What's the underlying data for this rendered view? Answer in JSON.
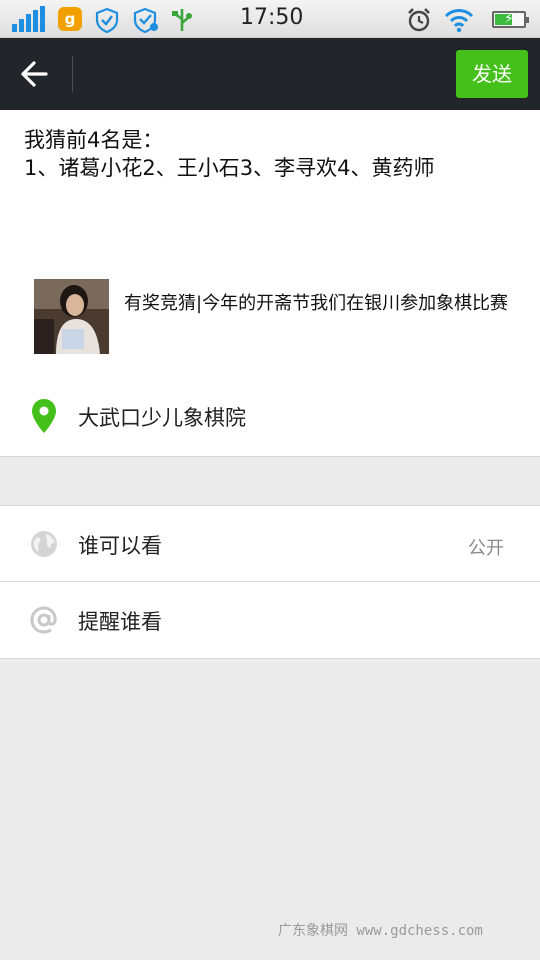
{
  "status_bar": {
    "time": "17:50",
    "app_badge": "g",
    "signal_strength": 4,
    "battery_level": 0.6,
    "icons": [
      "signal-icon",
      "app-g-icon",
      "shield-icon",
      "security-check-icon",
      "usb-icon",
      "alarm-icon",
      "wifi-icon",
      "battery-icon"
    ]
  },
  "title_bar": {
    "send_label": "发送",
    "accent_color": "#45c01a"
  },
  "compose": {
    "text_line1": "我猜前4名是：",
    "text_line2": "1、诸葛小花2、王小石3、李寻欢4、黄药师",
    "link_title": "有奖竞猜|今年的开斋节我们在银川参加象棋比赛",
    "location": "大武口少儿象棋院"
  },
  "settings": {
    "visibility_label": "谁可以看",
    "visibility_value": "公开",
    "mention_label": "提醒谁看"
  },
  "watermark": "广东象棋网 www.gdchess.com"
}
